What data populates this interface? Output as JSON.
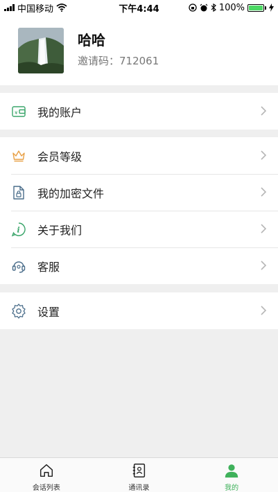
{
  "status_bar": {
    "carrier": "中国移动",
    "time": "下午4:44",
    "battery": "100%"
  },
  "profile": {
    "name": "哈哈",
    "invite_code": "邀请码：712061"
  },
  "menu": {
    "account": "我的账户",
    "membership": "会员等级",
    "encrypted_files": "我的加密文件",
    "about": "关于我们",
    "support": "客服",
    "settings": "设置"
  },
  "tabbar": {
    "chats": "会话列表",
    "contacts": "通讯录",
    "me": "我的",
    "active_color": "#3fb15b"
  },
  "colors": {
    "accent": "#3fb15b",
    "icon_green": "#3aa56a",
    "icon_orange": "#e8a045",
    "icon_blue": "#4a6d8a",
    "background": "#efefef"
  }
}
